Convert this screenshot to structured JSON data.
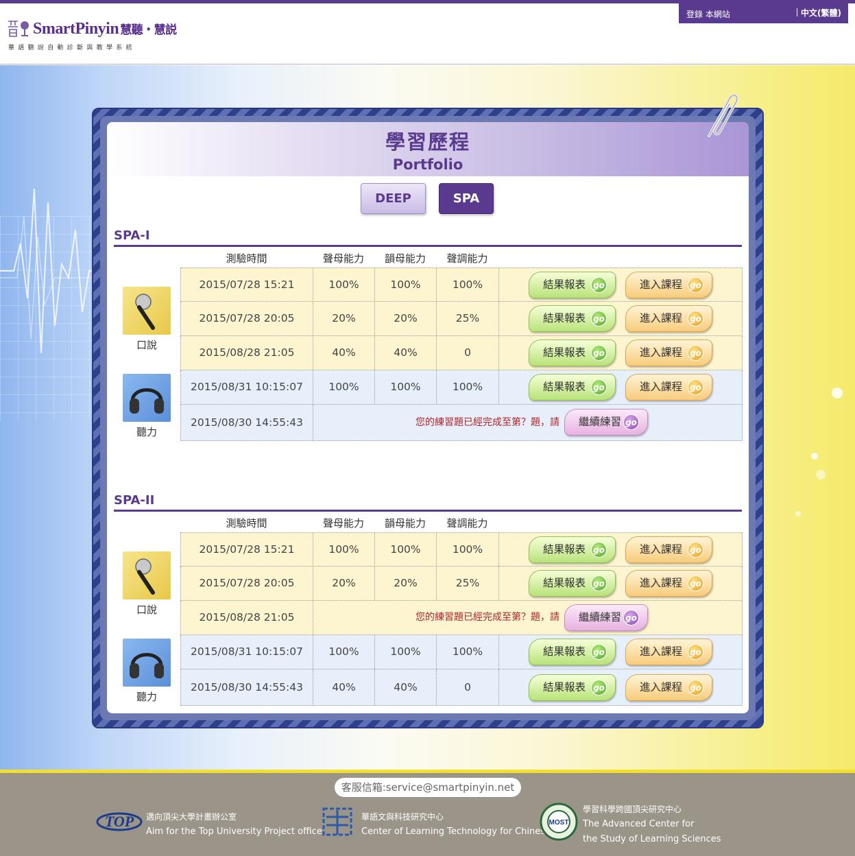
{
  "header": {
    "logo_text": "SmartPinyin",
    "logo_cn": "慧聽・慧説",
    "logo_sub": "華語聽說自動診斷與教學系統",
    "login": "登錄 本網站",
    "language": "中文(繁體)"
  },
  "page": {
    "title_cn": "學習歷程",
    "title_en": "Portfolio"
  },
  "tabs": [
    {
      "label": "DEEP",
      "active": false
    },
    {
      "label": "SPA",
      "active": true
    }
  ],
  "columns": {
    "time": "測驗時間",
    "initial": "聲母能力",
    "final": "韻母能力",
    "tone": "聲調能力"
  },
  "buttons": {
    "report": "結果報表",
    "course": "進入課程",
    "continue": "繼續練習",
    "go": "go"
  },
  "sections": [
    {
      "title": "SPA-I",
      "groups": [
        {
          "label": "口說",
          "icon": "microphone-icon",
          "rows": [
            {
              "time": "2015/07/28 15:21",
              "initial": "100%",
              "final": "100%",
              "tone": "100%"
            },
            {
              "time": "2015/07/28 20:05",
              "initial": "20%",
              "final": "20%",
              "tone": "25%"
            },
            {
              "time": "2015/08/28 21:05",
              "initial": "40%",
              "final": "40%",
              "tone": "0"
            }
          ]
        },
        {
          "label": "聽力",
          "icon": "headphones-icon",
          "rows": [
            {
              "time": "2015/08/31 10:15:07",
              "initial": "100%",
              "final": "100%",
              "tone": "100%"
            },
            {
              "time": "2015/08/30 14:55:43",
              "message": "您的練習題已經完成至第？題，請"
            }
          ]
        }
      ]
    },
    {
      "title": "SPA-II",
      "groups": [
        {
          "label": "口說",
          "icon": "microphone-icon",
          "rows": [
            {
              "time": "2015/07/28 15:21",
              "initial": "100%",
              "final": "100%",
              "tone": "100%"
            },
            {
              "time": "2015/07/28 20:05",
              "initial": "20%",
              "final": "20%",
              "tone": "25%"
            },
            {
              "time": "2015/08/28 21:05",
              "message": "您的練習題已經完成至第？題，請"
            }
          ]
        },
        {
          "label": "聽力",
          "icon": "headphones-icon",
          "rows": [
            {
              "time": "2015/08/31 10:15:07",
              "initial": "100%",
              "final": "100%",
              "tone": "100%"
            },
            {
              "time": "2015/08/30 14:55:43",
              "initial": "40%",
              "final": "40%",
              "tone": "0"
            }
          ]
        }
      ]
    }
  ],
  "footer": {
    "service": "客服信箱:service@smartpinyin.net",
    "orgs": [
      {
        "logo": "TOP",
        "line1": "邁向頂尖大學計畫辦公室",
        "line2": "Aim for the Top University Project office"
      },
      {
        "line1": "華語文與科技研究中心",
        "line2": "Center of Learning Technology for Chinese"
      },
      {
        "logo_text": "MOST",
        "line1": "學習科學跨國頂尖研究中心",
        "line2": "The Advanced Center for",
        "line3": "the Study of Learning Sciences"
      }
    ]
  },
  "colors": {
    "brand": "#5a3a8e",
    "error_text": "#b1232a",
    "speaking_row": "#fdf4d0",
    "listening_row": "#e7effb"
  }
}
